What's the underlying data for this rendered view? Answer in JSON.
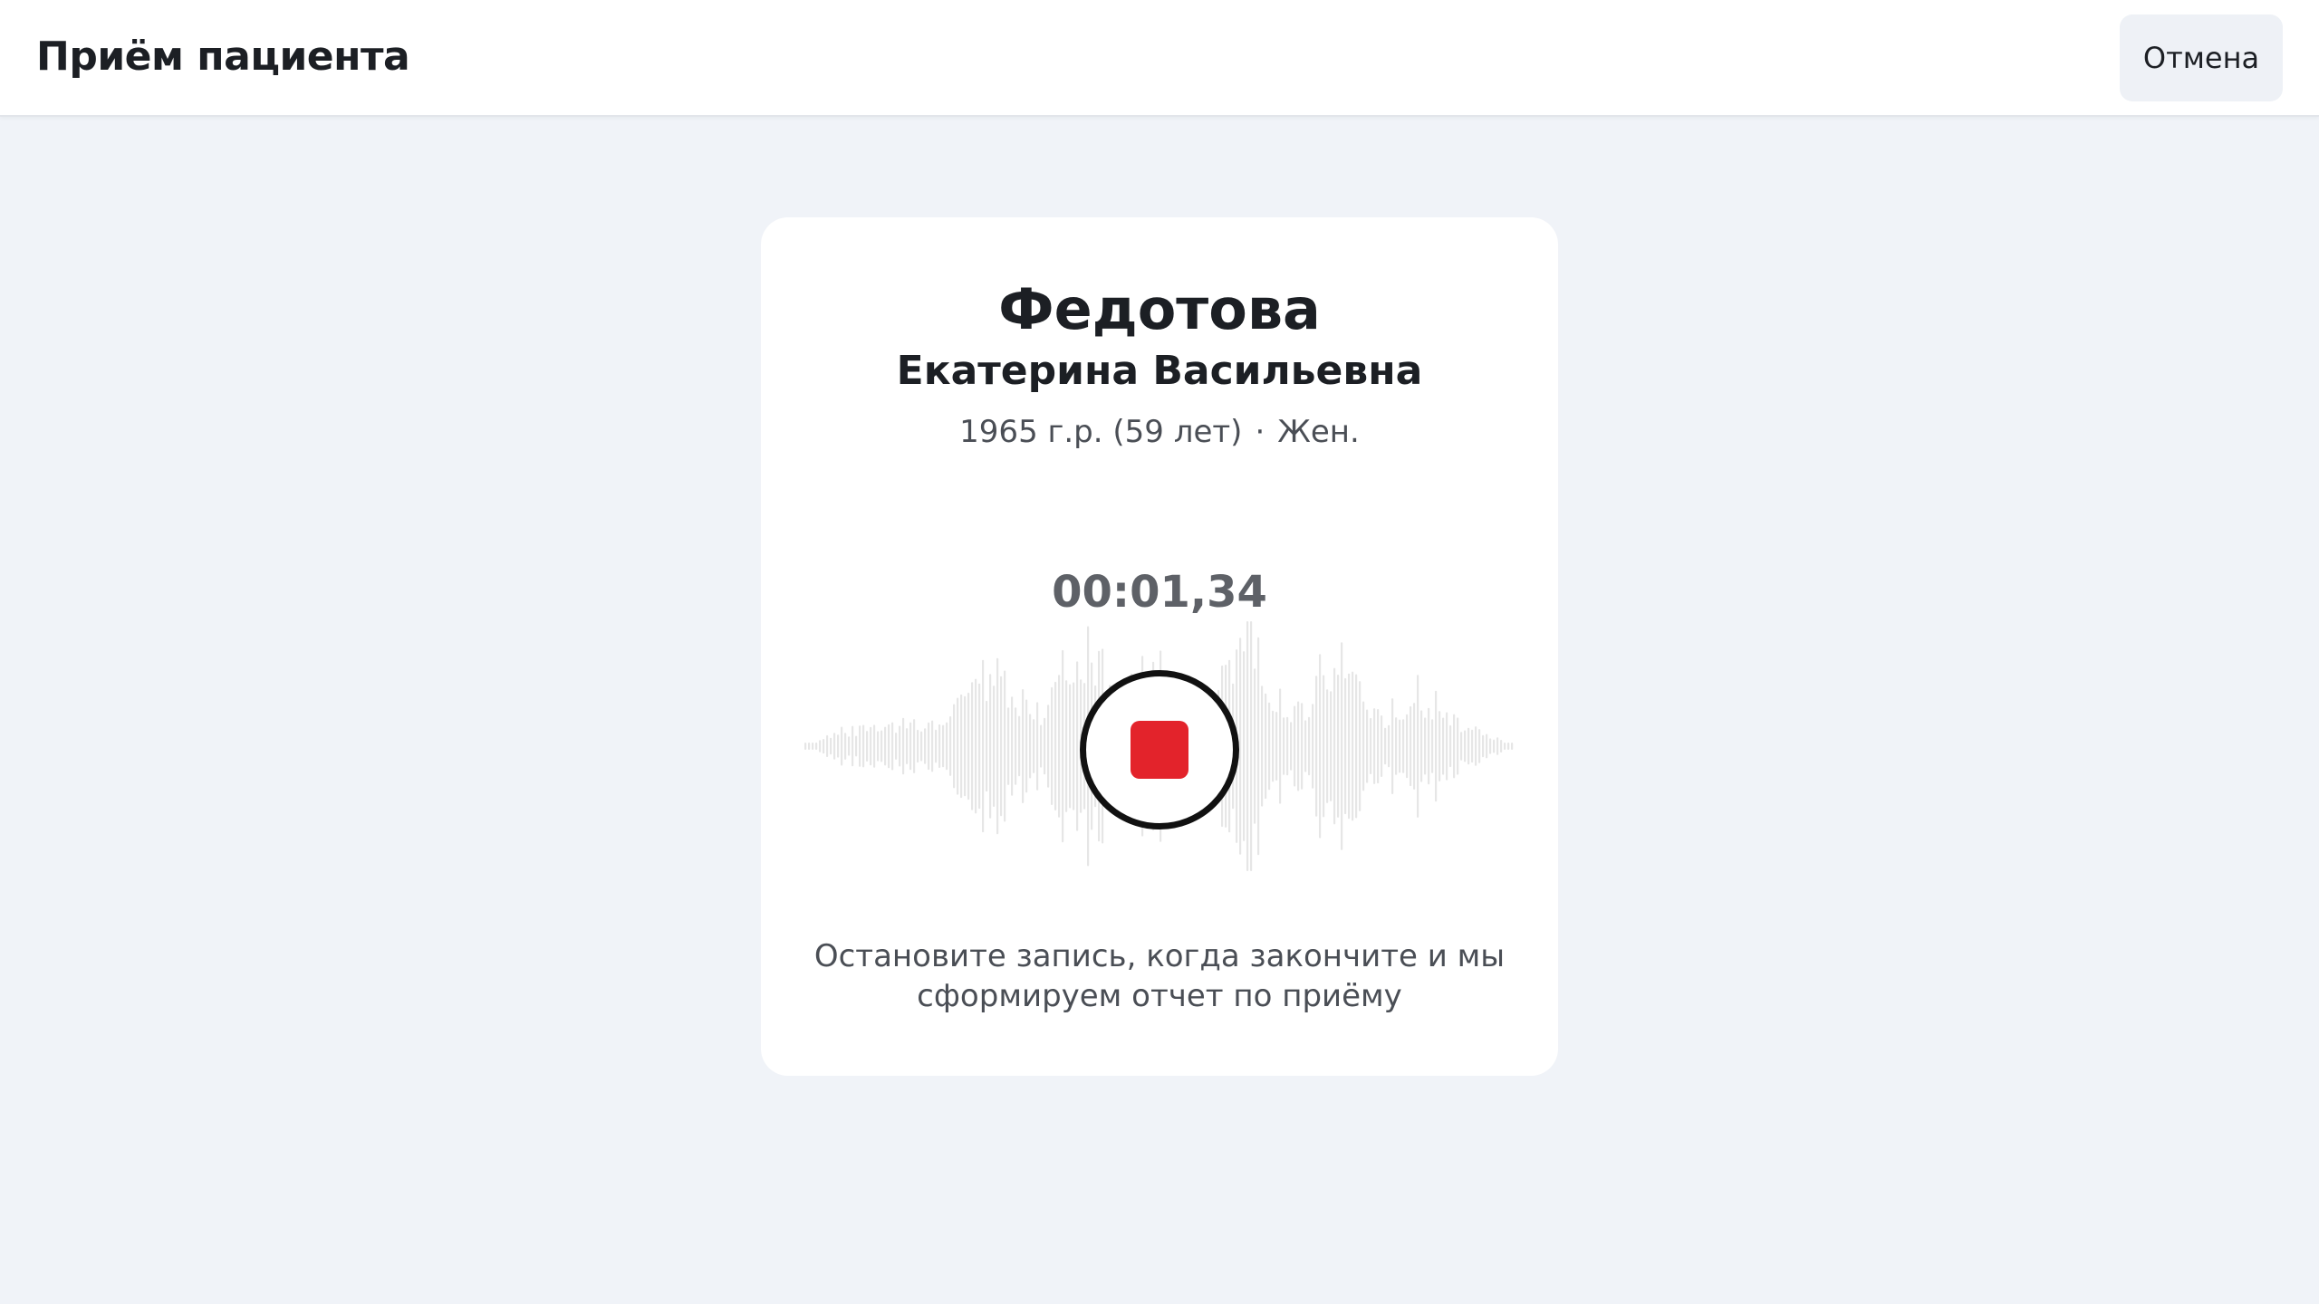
{
  "header": {
    "title": "Приём пациента",
    "cancel_label": "Отмена"
  },
  "patient": {
    "surname": "Федотова",
    "given_names": "Екатерина Васильевна",
    "birth_info": "1965 г.р. (59 лет)",
    "separator": "·",
    "gender": "Жен."
  },
  "recording": {
    "timer": "00:01,34",
    "stop_icon": "stop-icon",
    "hint_line1": "Остановите запись, когда закончите и мы",
    "hint_line2": "сформируем отчет по приёму"
  },
  "colors": {
    "background": "#f0f3f8",
    "card": "#ffffff",
    "stop_accent": "#e3232b",
    "waveform": "#e6e6e6"
  }
}
